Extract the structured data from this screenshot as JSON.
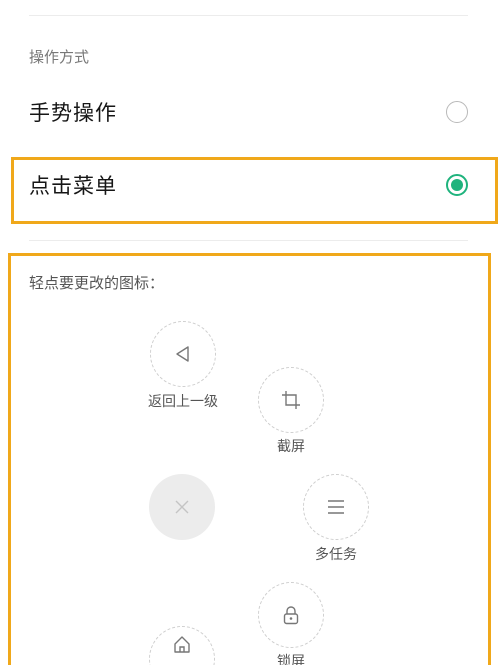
{
  "section": {
    "label": "操作方式"
  },
  "options": [
    {
      "label": "手势操作",
      "checked": false
    },
    {
      "label": "点击菜单",
      "checked": true
    }
  ],
  "panel": {
    "title": "轻点要更改的图标：",
    "buttons": {
      "back": {
        "label": "返回上一级",
        "icon": "back-triangle-icon"
      },
      "screenshot": {
        "label": "截屏",
        "icon": "crop-icon"
      },
      "close": {
        "label": "",
        "icon": "close-x-icon"
      },
      "multitask": {
        "label": "多任务",
        "icon": "menu-lines-icon"
      },
      "lock": {
        "label": "锁屏",
        "icon": "lock-icon"
      },
      "home": {
        "label": "",
        "icon": "home-icon"
      }
    }
  },
  "colors": {
    "accent": "#1fb37d",
    "highlight": "#f0a81a"
  }
}
